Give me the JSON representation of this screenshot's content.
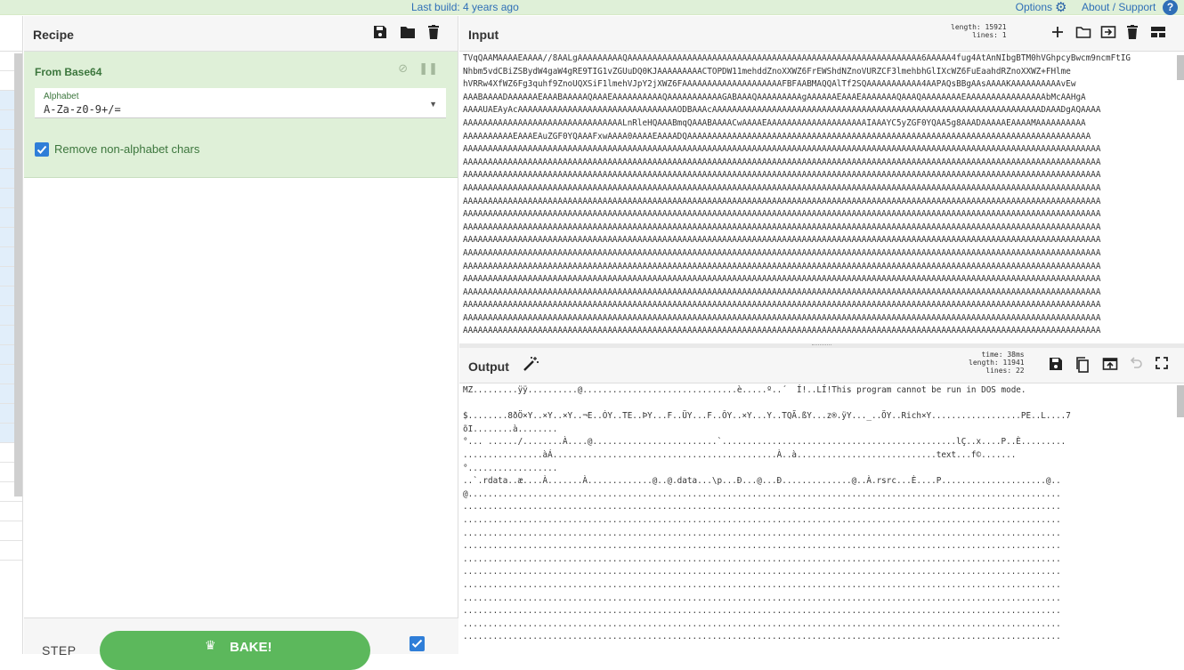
{
  "banner": {
    "last_build": "Last build: 4 years ago",
    "options": "Options",
    "about": "About / Support",
    "help": "?"
  },
  "recipe": {
    "title": "Recipe",
    "operation": {
      "name": "From Base64",
      "alphabet_label": "Alphabet",
      "alphabet_value": "A-Za-z0-9+/=",
      "remove_label": "Remove non-alphabet chars",
      "remove_checked": true
    },
    "step_label": "STEP",
    "bake_label": "BAKE!",
    "autobake_checked": true
  },
  "input": {
    "title": "Input",
    "length_label": "length: 15921",
    "lines_label": "lines:    1",
    "lines": [
      "TVqQAAMAAAAEAAAA//8AALgAAAAAAAAAQAAAAAAAAAAAAAAAAAAAAAAAAAAAAAAAAAAAAAAAAAAAAAAAAAAAAAAAAAAA6AAAAA4fug4AtAnNIbgBTM0hVGhpcyBwcm9ncmFtIG",
      "Nhbm5vdCBiZSBydW4gaW4gRE9TIG1vZGUuDQ0KJAAAAAAAAACTOPDW11mehddZnoXXWZ6FrEWShdNZnoVURZCF3lmehbhGlIXcWZ6FuEaahdRZnoXXWZ+FHlme",
      "hVRRw4XfWZ6Fg3quhf9ZnoUQXSiF1lmehVJpY2jXWZ6FAAAAAAAAAAAAAAAAAAAAFBFAABMAQQAlTf2SQAAAAAAAAAAA4AAPAQsBBgAAsAAAAKAAAAAAAAAAvEw",
      "AAABAAAADAAAAAAEAAABAAAAAQAAAEAAAAAAAAAAQAAAAAAAAAAAGABAAAQAAAAAAAAAgAAAAAAEAAAEAAAAAAAQAAAQAAAAAAAAEAAAAAAAAAAAAAAAAbMcAAHgA",
      "AAAAUAEAyAcAAAAAAAAAAAAAAAAAAAAAAAAAAAAAAAAODBAAAcAAAAAAAAAAAAAAAAAAAAAAAAAAAAAAAAAAAAAAAAAAAAAAAAAAAAAAAAAAAAAAAAAADAAADgAQAAAA",
      "AAAAAAAAAAAAAAAAAAAAAAAAAAAAAAAALnRleHQAAABmqQAAABAAAACwAAAAEAAAAAAAAAAAAAAAAAAAAIAAAYC5yZGF0YQAA5g8AAADAAAAAEAAAAMAAAAAAAAAA",
      "AAAAAAAAAAEAAAEAuZGF0YQAAAFxwAAAA0AAAAEAAAADQAAAAAAAAAAAAAAAAAAAAAAAAAAAAAAAAAAAAAAAAAAAAAAAAAAAAAAAAAAAAAAAAAAAAAAAAAAAAAAAAA",
      "AAAAAAAAAAAAAAAAAAAAAAAAAAAAAAAAAAAAAAAAAAAAAAAAAAAAAAAAAAAAAAAAAAAAAAAAAAAAAAAAAAAAAAAAAAAAAAAAAAAAAAAAAAAAAAAAAAAAAAAAAAAAAAAA",
      "AAAAAAAAAAAAAAAAAAAAAAAAAAAAAAAAAAAAAAAAAAAAAAAAAAAAAAAAAAAAAAAAAAAAAAAAAAAAAAAAAAAAAAAAAAAAAAAAAAAAAAAAAAAAAAAAAAAAAAAAAAAAAAAA",
      "AAAAAAAAAAAAAAAAAAAAAAAAAAAAAAAAAAAAAAAAAAAAAAAAAAAAAAAAAAAAAAAAAAAAAAAAAAAAAAAAAAAAAAAAAAAAAAAAAAAAAAAAAAAAAAAAAAAAAAAAAAAAAAAA",
      "AAAAAAAAAAAAAAAAAAAAAAAAAAAAAAAAAAAAAAAAAAAAAAAAAAAAAAAAAAAAAAAAAAAAAAAAAAAAAAAAAAAAAAAAAAAAAAAAAAAAAAAAAAAAAAAAAAAAAAAAAAAAAAAA",
      "AAAAAAAAAAAAAAAAAAAAAAAAAAAAAAAAAAAAAAAAAAAAAAAAAAAAAAAAAAAAAAAAAAAAAAAAAAAAAAAAAAAAAAAAAAAAAAAAAAAAAAAAAAAAAAAAAAAAAAAAAAAAAAAA",
      "AAAAAAAAAAAAAAAAAAAAAAAAAAAAAAAAAAAAAAAAAAAAAAAAAAAAAAAAAAAAAAAAAAAAAAAAAAAAAAAAAAAAAAAAAAAAAAAAAAAAAAAAAAAAAAAAAAAAAAAAAAAAAAAA",
      "AAAAAAAAAAAAAAAAAAAAAAAAAAAAAAAAAAAAAAAAAAAAAAAAAAAAAAAAAAAAAAAAAAAAAAAAAAAAAAAAAAAAAAAAAAAAAAAAAAAAAAAAAAAAAAAAAAAAAAAAAAAAAAAA",
      "AAAAAAAAAAAAAAAAAAAAAAAAAAAAAAAAAAAAAAAAAAAAAAAAAAAAAAAAAAAAAAAAAAAAAAAAAAAAAAAAAAAAAAAAAAAAAAAAAAAAAAAAAAAAAAAAAAAAAAAAAAAAAAAA",
      "AAAAAAAAAAAAAAAAAAAAAAAAAAAAAAAAAAAAAAAAAAAAAAAAAAAAAAAAAAAAAAAAAAAAAAAAAAAAAAAAAAAAAAAAAAAAAAAAAAAAAAAAAAAAAAAAAAAAAAAAAAAAAAAA",
      "AAAAAAAAAAAAAAAAAAAAAAAAAAAAAAAAAAAAAAAAAAAAAAAAAAAAAAAAAAAAAAAAAAAAAAAAAAAAAAAAAAAAAAAAAAAAAAAAAAAAAAAAAAAAAAAAAAAAAAAAAAAAAAAA",
      "AAAAAAAAAAAAAAAAAAAAAAAAAAAAAAAAAAAAAAAAAAAAAAAAAAAAAAAAAAAAAAAAAAAAAAAAAAAAAAAAAAAAAAAAAAAAAAAAAAAAAAAAAAAAAAAAAAAAAAAAAAAAAAAA",
      "AAAAAAAAAAAAAAAAAAAAAAAAAAAAAAAAAAAAAAAAAAAAAAAAAAAAAAAAAAAAAAAAAAAAAAAAAAAAAAAAAAAAAAAAAAAAAAAAAAAAAAAAAAAAAAAAAAAAAAAAAAAAAAAA",
      "AAAAAAAAAAAAAAAAAAAAAAAAAAAAAAAAAAAAAAAAAAAAAAAAAAAAAAAAAAAAAAAAAAAAAAAAAAAAAAAAAAAAAAAAAAAAAAAAAAAAAAAAAAAAAAAAAAAAAAAAAAAAAAAA",
      "AAAAAAAAAAAAAAAAAAAAAAAAAAAAAAAAAAAAAAAAAAAAAAAAAAAAAAAAAAAAAAAAAAAAAAAAAAAAAAAAAAAAAAAAAAAAAAAAAAAAAAAAAAAAAAAAAAAAAAAAAAAAAAAA",
      "AAAAAAAAAAAAAAAAAAAAAAAAAAAAAAAAAAAAAAAAAAAAAAAAAAAAAAAAAAAAAAAAAAAAAAAAAAAAAAAAAAAAAAAAAAAAAAAAAAAAAAAAAAAAAAAAAAAAAAAAAAAAAAAA"
    ]
  },
  "output": {
    "title": "Output",
    "time_label": "time:  38ms",
    "length_label": "length: 11941",
    "lines_label": "lines:   22",
    "lines": [
      "MZ.........ÿÿ..........@...............................è.....º..´  Í!..LÍ!This program cannot be run in DOS mode.",
      "",
      "$........8ðÖ×Y..×Y..×Y..¬E..ÓY..TE..ÞY...F..ÜY...F..ÔY..×Y...Y..TQÃ.ßY...z®.ÿY..._..ÖY..Rich×Y..................PE..L....7",
      "õI........à........",
      "°... ....../........À....@.........................`...............................................lÇ..x....P..È.........",
      "................àÁ.............................................À..à............................text...f©.......",
      "°..................",
      "..`.rdata..æ....À.......À.............@..@.data...\\p...Ð...@...Ð..............@..À.rsrc...È....P.....................@..",
      "@.......................................................................................................................",
      "........................................................................................................................",
      "........................................................................................................................",
      "........................................................................................................................",
      "........................................................................................................................",
      "........................................................................................................................",
      "........................................................................................................................",
      "........................................................................................................................",
      "........................................................................................................................",
      "........................................................................................................................",
      "........................................................................................................................",
      "........................................................................................................................"
    ]
  }
}
